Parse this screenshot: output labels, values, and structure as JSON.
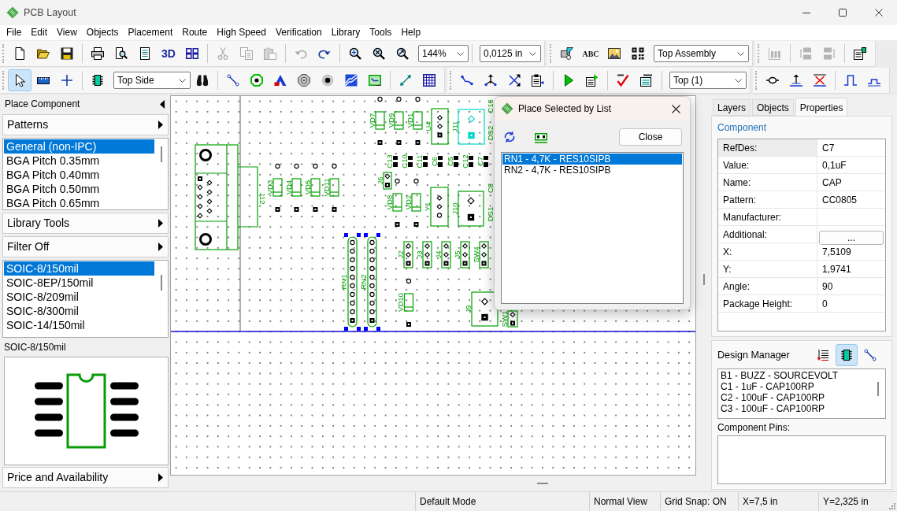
{
  "window": {
    "title": "PCB Layout"
  },
  "menu": [
    "File",
    "Edit",
    "View",
    "Objects",
    "Placement",
    "Route",
    "High Speed",
    "Verification",
    "Library",
    "Tools",
    "Help"
  ],
  "toolbar_rows": [
    {
      "bands": [
        {
          "items": [
            {
              "kind": "button",
              "disabled": false,
              "selected": false
            },
            {
              "kind": "button",
              "disabled": false,
              "selected": false
            },
            {
              "kind": "button",
              "disabled": false,
              "selected": false
            },
            {
              "kind": "separator"
            },
            {
              "kind": "button",
              "disabled": false,
              "selected": false
            },
            {
              "kind": "button",
              "disabled": false,
              "selected": false
            },
            {
              "kind": "button",
              "disabled": false,
              "selected": false
            },
            {
              "kind": "text_button",
              "label": "3D",
              "disabled": false,
              "selected": false
            },
            {
              "kind": "button",
              "disabled": false,
              "selected": false
            },
            {
              "kind": "separator"
            },
            {
              "kind": "button",
              "disabled": true,
              "selected": false
            },
            {
              "kind": "button",
              "disabled": true,
              "selected": false
            },
            {
              "kind": "button",
              "disabled": true,
              "selected": false
            },
            {
              "kind": "separator"
            },
            {
              "kind": "button",
              "disabled": true,
              "selected": false
            },
            {
              "kind": "button",
              "disabled": false,
              "selected": false
            },
            {
              "kind": "separator"
            },
            {
              "kind": "button",
              "disabled": false,
              "selected": false
            },
            {
              "kind": "button",
              "disabled": false,
              "selected": false
            },
            {
              "kind": "button",
              "disabled": false,
              "selected": false
            },
            {
              "kind": "combo",
              "value": "144%"
            },
            {
              "kind": "separator"
            },
            {
              "kind": "combo",
              "value": "0,0125 in"
            }
          ]
        },
        {
          "items": [
            {
              "kind": "button",
              "disabled": false,
              "selected": false
            },
            {
              "kind": "text_button",
              "label": "ABC",
              "disabled": false,
              "selected": false
            },
            {
              "kind": "button",
              "disabled": false,
              "selected": false
            },
            {
              "kind": "button",
              "disabled": false,
              "selected": false
            },
            {
              "kind": "combo",
              "value": "Top Assembly"
            }
          ]
        },
        {
          "items": [
            {
              "kind": "button",
              "disabled": true,
              "selected": false
            },
            {
              "kind": "separator"
            },
            {
              "kind": "button",
              "disabled": true,
              "selected": false
            },
            {
              "kind": "button",
              "disabled": true,
              "selected": false
            },
            {
              "kind": "separator"
            },
            {
              "kind": "button",
              "disabled": false,
              "selected": false
            }
          ]
        }
      ]
    },
    {
      "bands": [
        {
          "items": [
            {
              "kind": "button",
              "disabled": false,
              "selected": true
            },
            {
              "kind": "button",
              "disabled": false,
              "selected": false
            },
            {
              "kind": "button",
              "disabled": false,
              "selected": false
            },
            {
              "kind": "separator"
            },
            {
              "kind": "button",
              "disabled": false,
              "selected": false
            },
            {
              "kind": "combo",
              "value": "Top Side"
            },
            {
              "kind": "button",
              "disabled": false,
              "selected": false
            },
            {
              "kind": "separator"
            },
            {
              "kind": "button",
              "disabled": false,
              "selected": false
            },
            {
              "kind": "button",
              "disabled": false,
              "selected": false
            },
            {
              "kind": "button",
              "disabled": false,
              "selected": false
            },
            {
              "kind": "button",
              "disabled": false,
              "selected": false
            },
            {
              "kind": "button",
              "disabled": false,
              "selected": false
            },
            {
              "kind": "button",
              "disabled": false,
              "selected": false
            },
            {
              "kind": "button",
              "disabled": false,
              "selected": false
            },
            {
              "kind": "separator"
            },
            {
              "kind": "button",
              "disabled": false,
              "selected": false
            },
            {
              "kind": "button",
              "disabled": false,
              "selected": false
            }
          ]
        },
        {
          "items": [
            {
              "kind": "button",
              "disabled": false,
              "selected": false
            },
            {
              "kind": "button",
              "disabled": false,
              "selected": false
            },
            {
              "kind": "button",
              "disabled": false,
              "selected": false
            },
            {
              "kind": "button",
              "disabled": false,
              "selected": false
            },
            {
              "kind": "separator"
            },
            {
              "kind": "button",
              "disabled": false,
              "selected": false
            },
            {
              "kind": "button",
              "disabled": false,
              "selected": false
            },
            {
              "kind": "separator"
            },
            {
              "kind": "button",
              "disabled": false,
              "selected": false
            },
            {
              "kind": "button",
              "disabled": false,
              "selected": false
            },
            {
              "kind": "separator"
            },
            {
              "kind": "combo",
              "value": "Top (1)"
            }
          ]
        },
        {
          "items": [
            {
              "kind": "button",
              "disabled": false,
              "selected": false
            },
            {
              "kind": "button",
              "disabled": false,
              "selected": false
            },
            {
              "kind": "button",
              "disabled": false,
              "selected": false
            },
            {
              "kind": "separator"
            },
            {
              "kind": "button",
              "disabled": false,
              "selected": false
            },
            {
              "kind": "button",
              "disabled": false,
              "selected": false
            }
          ]
        }
      ]
    }
  ],
  "place_component": {
    "title": "Place Component",
    "patterns_button": "Patterns",
    "pattern_groups": [
      {
        "label": "General (non-IPC)",
        "selected": true
      },
      {
        "label": "BGA Pitch 0.35mm",
        "selected": false
      },
      {
        "label": "BGA Pitch 0.40mm",
        "selected": false
      },
      {
        "label": "BGA Pitch 0.50mm",
        "selected": false
      },
      {
        "label": "BGA Pitch 0.65mm",
        "selected": false
      }
    ],
    "library_tools_button": "Library Tools",
    "filter_button": "Filter Off",
    "patterns": [
      {
        "label": "SOIC-8/150mil",
        "selected": true
      },
      {
        "label": "SOIC-8EP/150mil",
        "selected": false
      },
      {
        "label": "SOIC-8/209mil",
        "selected": false
      },
      {
        "label": "SOIC-8/300mil",
        "selected": false
      },
      {
        "label": "SOIC-14/150mil",
        "selected": false
      }
    ],
    "preview_title": "SOIC-8/150mil",
    "price_button": "Price and Availability"
  },
  "canvas": {
    "components": [
      {
        "refdes": "J12",
        "kind": "db9",
        "selected": false,
        "highlighted": false
      },
      {
        "refdes": "VD3",
        "kind": "diode",
        "selected": false,
        "highlighted": false
      },
      {
        "refdes": "VD4",
        "kind": "diode",
        "selected": false,
        "highlighted": false
      },
      {
        "refdes": "VD5",
        "kind": "diode",
        "selected": false,
        "highlighted": false
      },
      {
        "refdes": "VD11",
        "kind": "diode",
        "selected": false,
        "highlighted": false
      },
      {
        "refdes": "VD7",
        "kind": "diode",
        "selected": false,
        "highlighted": false
      },
      {
        "refdes": "VD9",
        "kind": "diode",
        "selected": false,
        "highlighted": false
      },
      {
        "refdes": "VD1",
        "kind": "diode",
        "selected": false,
        "highlighted": false
      },
      {
        "refdes": "U4",
        "kind": "header",
        "selected": false,
        "highlighted": false
      },
      {
        "refdes": "J11",
        "kind": "jack",
        "selected": false,
        "highlighted": true
      },
      {
        "refdes": "C16",
        "kind": "label",
        "selected": false,
        "highlighted": false
      },
      {
        "refdes": "DS2",
        "kind": "label",
        "selected": false,
        "highlighted": false
      },
      {
        "refdes": "C13",
        "kind": "capacitor",
        "selected": false,
        "highlighted": false
      },
      {
        "refdes": "C10",
        "kind": "capacitor",
        "selected": false,
        "highlighted": false
      },
      {
        "refdes": "C11",
        "kind": "capacitor",
        "selected": false,
        "highlighted": false
      },
      {
        "refdes": "C6",
        "kind": "capacitor",
        "selected": false,
        "highlighted": false
      },
      {
        "refdes": "C5",
        "kind": "capacitor",
        "selected": false,
        "highlighted": false
      },
      {
        "refdes": "C12",
        "kind": "capacitor",
        "selected": false,
        "highlighted": false
      },
      {
        "refdes": "C7",
        "kind": "capacitor",
        "selected": false,
        "highlighted": false
      },
      {
        "refdes": "J6",
        "kind": "header",
        "selected": false,
        "highlighted": false
      },
      {
        "refdes": "VD8",
        "kind": "diode",
        "selected": false,
        "highlighted": false
      },
      {
        "refdes": "VD2",
        "kind": "diode",
        "selected": false,
        "highlighted": false
      },
      {
        "refdes": "Y1",
        "kind": "header",
        "selected": false,
        "highlighted": false
      },
      {
        "refdes": "J10",
        "kind": "jack",
        "selected": false,
        "highlighted": false
      },
      {
        "refdes": "C8",
        "kind": "label",
        "selected": false,
        "highlighted": false
      },
      {
        "refdes": "DS1",
        "kind": "label",
        "selected": false,
        "highlighted": false
      },
      {
        "refdes": "RN1",
        "kind": "resistor_network",
        "selected": true,
        "highlighted": false
      },
      {
        "refdes": "RN2",
        "kind": "resistor_network",
        "selected": true,
        "highlighted": false
      },
      {
        "refdes": "J2",
        "kind": "header",
        "selected": false,
        "highlighted": false
      },
      {
        "refdes": "J3",
        "kind": "header",
        "selected": false,
        "highlighted": false
      },
      {
        "refdes": "J4",
        "kind": "header",
        "selected": false,
        "highlighted": false
      },
      {
        "refdes": "J5",
        "kind": "header",
        "selected": false,
        "highlighted": false
      },
      {
        "refdes": "SW4",
        "kind": "header",
        "selected": false,
        "highlighted": false
      },
      {
        "refdes": "VD10",
        "kind": "diode",
        "selected": false,
        "highlighted": false
      },
      {
        "refdes": "J9",
        "kind": "jack",
        "selected": false,
        "highlighted": false
      },
      {
        "refdes": "SW1",
        "kind": "header",
        "selected": false,
        "highlighted": false
      }
    ]
  },
  "dialog": {
    "title": "Place Selected by List",
    "close_button": "Close",
    "items": [
      {
        "label": "RN1 - 4,7K - RES10SIPB",
        "selected": true
      },
      {
        "label": "RN2 - 4,7K - RES10SIPB",
        "selected": false
      }
    ]
  },
  "properties_panel": {
    "tabs": [
      {
        "label": "Layers",
        "selected": false
      },
      {
        "label": "Objects",
        "selected": false
      },
      {
        "label": "Properties",
        "selected": true
      }
    ],
    "section_title": "Component",
    "properties": [
      {
        "name": "RefDes:",
        "value": "C7",
        "kind": "text",
        "selected": true
      },
      {
        "name": "Value:",
        "value": "0,1uF",
        "kind": "text",
        "selected": false
      },
      {
        "name": "Name:",
        "value": "CAP",
        "kind": "text",
        "selected": false
      },
      {
        "name": "Pattern:",
        "value": "CC0805",
        "kind": "text",
        "selected": false
      },
      {
        "name": "Manufacturer:",
        "kind": "text",
        "selected": false
      },
      {
        "name": "Additional:",
        "value": "...",
        "kind": "button",
        "selected": false
      },
      {
        "name": "X:",
        "value": "7,5109",
        "kind": "text",
        "selected": false
      },
      {
        "name": "Y:",
        "value": "1,9741",
        "kind": "text",
        "selected": false
      },
      {
        "name": "Angle:",
        "value": "90",
        "kind": "text",
        "selected": false
      },
      {
        "name": "Package Height:",
        "value": "0",
        "kind": "text",
        "selected": false
      }
    ]
  },
  "design_manager": {
    "title": "Design Manager",
    "views": [
      {
        "selected": false
      },
      {
        "selected": true
      },
      {
        "selected": false
      }
    ],
    "items": [
      "B1 - BUZZ - SOURCEVOLT",
      "C1 - 1uF - CAP100RP",
      "C2 - 100uF - CAP100RP",
      "C3 - 100uF - CAP100RP"
    ],
    "pins_label": "Component Pins:"
  },
  "status_bar": [
    "Default Mode",
    "Normal View",
    "Grid Snap: ON",
    "X=7,5 in",
    "Y=2,325 in"
  ]
}
